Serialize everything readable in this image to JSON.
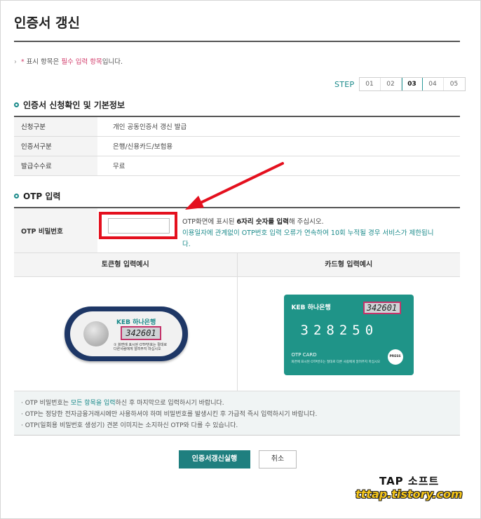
{
  "page": {
    "title": "인증서 갱신"
  },
  "required_note": {
    "bullet": "›",
    "star": "*",
    "pre": "표시 항목은 ",
    "emph": "필수 입력 항목",
    "post": "입니다."
  },
  "steps": {
    "label": "STEP",
    "items": [
      "01",
      "02",
      "03",
      "04",
      "05"
    ],
    "active": "03"
  },
  "section_basic": {
    "title": "인증서 신청확인 및 기본정보",
    "rows": [
      {
        "label": "신청구분",
        "value": "개인 공동인증서 갱신 발급"
      },
      {
        "label": "인증서구분",
        "value": "은행/신용카드/보험용"
      },
      {
        "label": "발급수수료",
        "value": "무료"
      }
    ]
  },
  "section_otp": {
    "title": "OTP 입력",
    "field_label": "OTP 비밀번호",
    "input_value": "",
    "desc_pre": "OTP화면에 표시된 ",
    "desc_bold": "6자리 숫자를 입력",
    "desc_post": "해 주십시오.",
    "desc_warn": "이용일자에 관계없이 OTP번호 입력 오류가 연속하여 10회 누적될 경우 서비스가 제한됩니다."
  },
  "examples": {
    "token_title": "토큰형 입력예시",
    "card_title": "카드형 입력예시",
    "token": {
      "brand": "KEB 하나은행",
      "display": "342601",
      "note": "① 화면에 표시된 OTP번호는 절대로 다른사람에게 알려주지 마십시오"
    },
    "card": {
      "brand": "KEB 하나은행",
      "display": "342601",
      "digits": "328250",
      "label": "OTP CARD",
      "fine": "화면에 표시된 OTP번호는 절대로 다른 사람에게 알려주지 마십시오",
      "press": "PRESS"
    }
  },
  "notes": {
    "line1_pre": "· OTP 비밀번호는 ",
    "line1_emph": "모든 항목을 입력",
    "line1_post": "하신 후 마지막으로 입력하시기 바랍니다.",
    "line2": "· OTP는 정당한 전자금융거래시에만 사용하셔야 하며 비밀번호를 발생시킨 후 가급적 즉시 입력하시기 바랍니다.",
    "line3": "· OTP(일회용 비밀번호 생성기) 견본 이미지는 소지하신 OTP와 다를 수 있습니다."
  },
  "buttons": {
    "submit": "인증서갱신실행",
    "cancel": "취소"
  },
  "watermark": {
    "title": "TAP 소프트",
    "url": "tttap.tistory.com"
  },
  "colors": {
    "accent": "#1f7f7f",
    "emphasis": "#d23c6b",
    "highlight_box": "#e4101e"
  }
}
